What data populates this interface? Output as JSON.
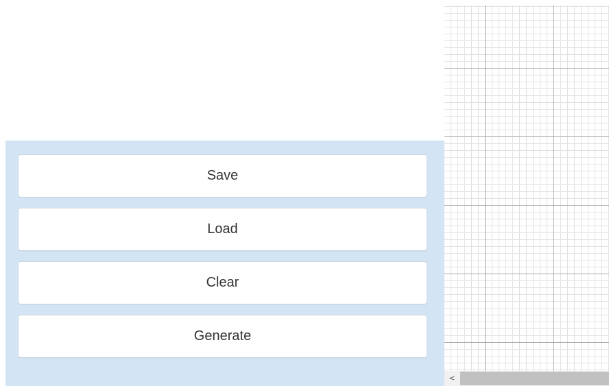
{
  "toolbar": {
    "buttons": [
      {
        "id": "save",
        "label": "Save"
      },
      {
        "id": "load",
        "label": "Load"
      },
      {
        "id": "clear",
        "label": "Clear"
      },
      {
        "id": "generate",
        "label": "Generate"
      }
    ]
  },
  "canvas": {
    "grid": true,
    "scroll_left_icon": "chevron-left-icon",
    "scroll_left_glyph": "<"
  },
  "colors": {
    "panel_background": "#d3e5f5",
    "button_background": "#ffffff",
    "button_text": "#333333",
    "grid_major": "#a9a9a9",
    "grid_minor": "#e2e2e2",
    "scrollbar_thumb": "#c1c1c1"
  }
}
